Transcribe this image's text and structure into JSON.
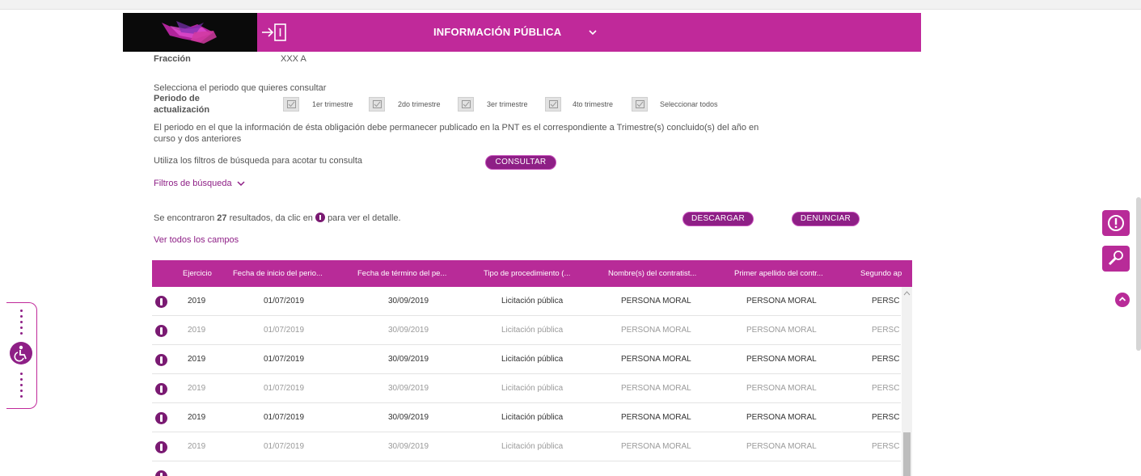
{
  "header": {
    "title": "INFORMACIÓN PÚBLICA"
  },
  "fraccion": {
    "label": "Fracción",
    "value": "XXX A"
  },
  "periodo": {
    "prompt": "Selecciona el periodo que quieres consultar",
    "label_line1": "Periodo de",
    "label_line2": "actualización",
    "options": [
      {
        "label": "1er trimestre",
        "checked": true
      },
      {
        "label": "2do trimestre",
        "checked": true
      },
      {
        "label": "3er trimestre",
        "checked": true
      },
      {
        "label": "4to trimestre",
        "checked": true
      },
      {
        "label": "Seleccionar todos",
        "checked": true
      }
    ],
    "note_line1": "El periodo en el que la información de ésta obligación debe permanecer publicado en la PNT es el correspondiente a Trimestre(s) concluido(s) del año en",
    "note_line2": "curso y dos anteriores"
  },
  "filters": {
    "hint": "Utiliza los filtros de búsqueda para acotar tu consulta",
    "consultar": "CONSULTAR",
    "toggle": "Filtros de búsqueda"
  },
  "results": {
    "prefix": "Se encontraron",
    "count": "27",
    "suffix_before_icon": "resultados, da clic en",
    "suffix_after_icon": "para ver el detalle.",
    "descargar": "DESCARGAR",
    "denunciar": "DENUNCIAR",
    "ver_todos": "Ver todos los campos"
  },
  "table": {
    "columns": [
      "Ejercicio",
      "Fecha de inicio del perio...",
      "Fecha de término del pe...",
      "Tipo de procedimiento (...",
      "Nombre(s) del contratist...",
      "Primer apellido del contr...",
      "Segundo ap"
    ],
    "rows": [
      {
        "style": "dark",
        "cells": [
          "2019",
          "01/07/2019",
          "30/09/2019",
          "Licitación pública",
          "PERSONA MORAL",
          "PERSONA MORAL",
          "PERSC"
        ]
      },
      {
        "style": "light",
        "cells": [
          "2019",
          "01/07/2019",
          "30/09/2019",
          "Licitación pública",
          "PERSONA MORAL",
          "PERSONA MORAL",
          "PERSC"
        ]
      },
      {
        "style": "dark",
        "cells": [
          "2019",
          "01/07/2019",
          "30/09/2019",
          "Licitación pública",
          "PERSONA MORAL",
          "PERSONA MORAL",
          "PERSC"
        ]
      },
      {
        "style": "light",
        "cells": [
          "2019",
          "01/07/2019",
          "30/09/2019",
          "Licitación pública",
          "PERSONA MORAL",
          "PERSONA MORAL",
          "PERSC"
        ]
      },
      {
        "style": "dark",
        "cells": [
          "2019",
          "01/07/2019",
          "30/09/2019",
          "Licitación pública",
          "PERSONA MORAL",
          "PERSONA MORAL",
          "PERSC"
        ]
      },
      {
        "style": "light",
        "cells": [
          "2019",
          "01/07/2019",
          "30/09/2019",
          "Licitación pública",
          "PERSONA MORAL",
          "PERSONA MORAL",
          "PERSC"
        ]
      }
    ]
  },
  "colors": {
    "brand_magenta": "#c0299a",
    "brand_purple": "#8e1f86"
  }
}
